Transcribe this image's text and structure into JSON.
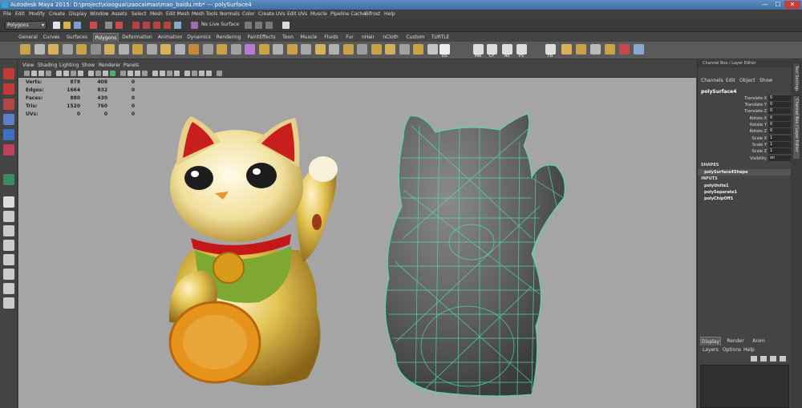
{
  "window": {
    "title": "Autodesk Maya 2015: D:\\project\\xiaoguai\\zaocaimao\\mao_baidu.mb*   ---   polySurface4",
    "minimize": "—",
    "maximize": "☐",
    "close": "✕"
  },
  "menubar": [
    "File",
    "Edit",
    "Modify",
    "Create",
    "Display",
    "Window",
    "Assets",
    "Select",
    "Mesh",
    "Edit Mesh",
    "Mesh Tools",
    "Normals",
    "Color",
    "Create UVs",
    "Edit UVs",
    "Muscle",
    "Pipeline Cache",
    "Bifrost",
    "Help"
  ],
  "statusline": {
    "mode": "Polygons",
    "mode_arrow": "▾",
    "live_surface": "No Live Surface"
  },
  "shelf_tabs": {
    "items": [
      "General",
      "Curves",
      "Surfaces",
      "Polygons",
      "Deformation",
      "Animation",
      "Dynamics",
      "Rendering",
      "PaintEffects",
      "Toon",
      "Muscle",
      "Fluids",
      "Fur",
      "nHair",
      "nCloth",
      "Custom",
      "TURTLE"
    ],
    "active": "Polygons"
  },
  "shelf_labels": [
    "DS",
    "Mel",
    "CP",
    "All",
    "PS",
    "FB"
  ],
  "panel_menu": [
    "View",
    "Shading",
    "Lighting",
    "Show",
    "Renderer",
    "Panels"
  ],
  "hud": {
    "rows": [
      {
        "label": "Verts:",
        "v1": "878",
        "v2": "408",
        "v3": "0"
      },
      {
        "label": "Edges:",
        "v1": "1664",
        "v2": "832",
        "v3": "0"
      },
      {
        "label": "Faces:",
        "v1": "880",
        "v2": "430",
        "v3": "0"
      },
      {
        "label": "Tris:",
        "v1": "1520",
        "v2": "760",
        "v3": "0"
      },
      {
        "label": "UVs:",
        "v1": "0",
        "v2": "0",
        "v3": "0"
      }
    ]
  },
  "channel_box": {
    "header": "Channel Box / Layer Editor",
    "menu": [
      "Channels",
      "Edit",
      "Object",
      "Show"
    ],
    "object_name": "polySurface4",
    "attributes": [
      {
        "name": "Translate X",
        "value": "0"
      },
      {
        "name": "Translate Y",
        "value": "0"
      },
      {
        "name": "Translate Z",
        "value": "0"
      },
      {
        "name": "Rotate X",
        "value": "0"
      },
      {
        "name": "Rotate Y",
        "value": "0"
      },
      {
        "name": "Rotate Z",
        "value": "0"
      },
      {
        "name": "Scale X",
        "value": "1"
      },
      {
        "name": "Scale Y",
        "value": "1"
      },
      {
        "name": "Scale Z",
        "value": "1"
      },
      {
        "name": "Visibility",
        "value": "on"
      }
    ],
    "shapes_label": "SHAPES",
    "shapes": [
      "polySurface4Shape"
    ],
    "inputs_label": "INPUTS",
    "inputs": [
      "polyUnite1",
      "polySeparate1",
      "polyChipOff1"
    ]
  },
  "layer_editor": {
    "tabs": [
      "Display",
      "Render",
      "Anim"
    ],
    "active": "Display",
    "menu": [
      "Layers",
      "Options",
      "Help"
    ]
  },
  "side_tabs": [
    "Tool Settings",
    "Channel Box / Layer Editor"
  ],
  "colors": {
    "viewport_bg": "#a5a5a5",
    "wireframe": "#4fe0b0",
    "mesh_shaded": "#5d5d5d",
    "gold": "#d8b43a",
    "title_bar": "#3f6fa3"
  }
}
